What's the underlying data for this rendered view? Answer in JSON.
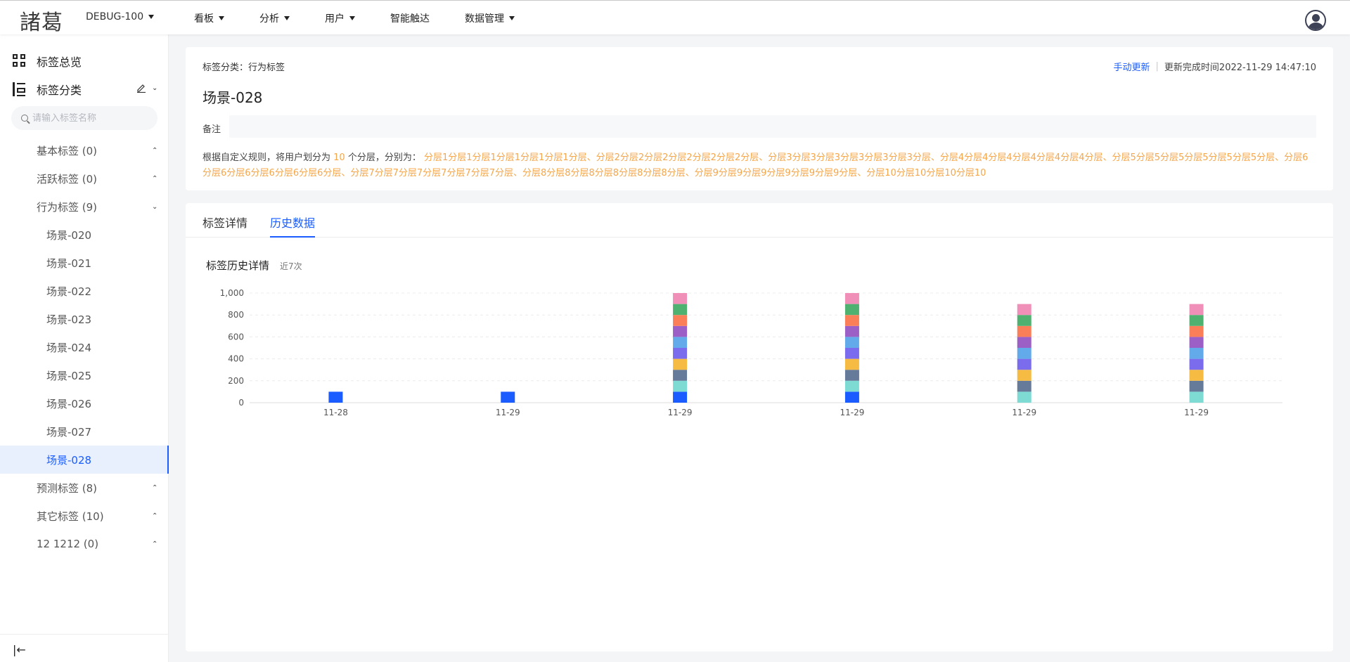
{
  "header": {
    "logo_text": "諸葛",
    "project": "DEBUG-100",
    "nav": [
      {
        "label": "看板",
        "has_dropdown": true
      },
      {
        "label": "分析",
        "has_dropdown": true
      },
      {
        "label": "用户",
        "has_dropdown": true
      },
      {
        "label": "智能触达",
        "has_dropdown": false
      },
      {
        "label": "数据管理",
        "has_dropdown": true
      }
    ],
    "avatar_icon": "user-avatar-icon"
  },
  "sidebar": {
    "overview_label": "标签总览",
    "category_label": "标签分类",
    "search_placeholder": "请输入标签名称",
    "groups": [
      {
        "label": "基本标签  (0)",
        "expanded": false
      },
      {
        "label": "活跃标签  (0)",
        "expanded": false
      },
      {
        "label": "行为标签  (9)",
        "expanded": true
      },
      {
        "label": "预测标签  (8)",
        "expanded": false
      },
      {
        "label": "其它标签  (10)",
        "expanded": false
      },
      {
        "label": "12 1212  (0)",
        "expanded": false
      }
    ],
    "behavior_items": [
      "场景-020",
      "场景-021",
      "场景-022",
      "场景-023",
      "场景-024",
      "场景-025",
      "场景-026",
      "场景-027",
      "场景-028"
    ],
    "active_item": "场景-028"
  },
  "info": {
    "category_line": "标签分类：行为标签",
    "manual_update": "手动更新",
    "update_time": "更新完成时间2022-11-29 14:47:10",
    "title": "场景-028",
    "note_label": "备注",
    "note_value": "",
    "rule_prefix": "根据自定义规则，将用户划分为 ",
    "rule_count": "10",
    "rule_mid": " 个分层，分别为：",
    "rule_layers": " 分层1分层1分层1分层1分层1分层1分层、分层2分层2分层2分层2分层2分层2分层、分层3分层3分层3分层3分层3分层3分层、分层4分层4分层4分层4分层4分层4分层、分层5分层5分层5分层5分层5分层5分层、分层6分层6分层6分层6分层6分层6分层、分层7分层7分层7分层7分层7分层7分层、分层8分层8分层8分层8分层8分层8分层、分层9分层9分层9分层9分层9分层9分层、分层10分层10分层10分层10"
  },
  "tabs": [
    {
      "label": "标签详情",
      "active": false
    },
    {
      "label": "历史数据",
      "active": true
    }
  ],
  "chart_title": "标签历史详情",
  "chart_subtitle": "近7次",
  "chart_data": {
    "type": "bar",
    "stacked": true,
    "categories": [
      "11-28",
      "11-29",
      "11-29",
      "11-29",
      "11-29",
      "11-29"
    ],
    "series": [
      {
        "color": "#1a5cff",
        "values": [
          100,
          100,
          100,
          100,
          0,
          0
        ]
      },
      {
        "color": "#7ddbd3",
        "values": [
          0,
          0,
          100,
          100,
          100,
          100
        ]
      },
      {
        "color": "#667a99",
        "values": [
          0,
          0,
          100,
          100,
          100,
          100
        ]
      },
      {
        "color": "#f5bb42",
        "values": [
          0,
          0,
          100,
          100,
          100,
          100
        ]
      },
      {
        "color": "#7a6cec",
        "values": [
          0,
          0,
          100,
          100,
          100,
          100
        ]
      },
      {
        "color": "#63aaea",
        "values": [
          0,
          0,
          100,
          100,
          100,
          100
        ]
      },
      {
        "color": "#9c5fc6",
        "values": [
          0,
          0,
          100,
          100,
          100,
          100
        ]
      },
      {
        "color": "#fa7e58",
        "values": [
          0,
          0,
          100,
          100,
          100,
          100
        ]
      },
      {
        "color": "#4eb170",
        "values": [
          0,
          0,
          100,
          100,
          100,
          100
        ]
      },
      {
        "color": "#f08fb8",
        "values": [
          0,
          0,
          100,
          100,
          100,
          100
        ]
      }
    ],
    "yticks": [
      "0",
      "200",
      "400",
      "600",
      "800",
      "1,000"
    ],
    "ylim": [
      0,
      1000
    ],
    "grid": true,
    "legend": "none"
  }
}
